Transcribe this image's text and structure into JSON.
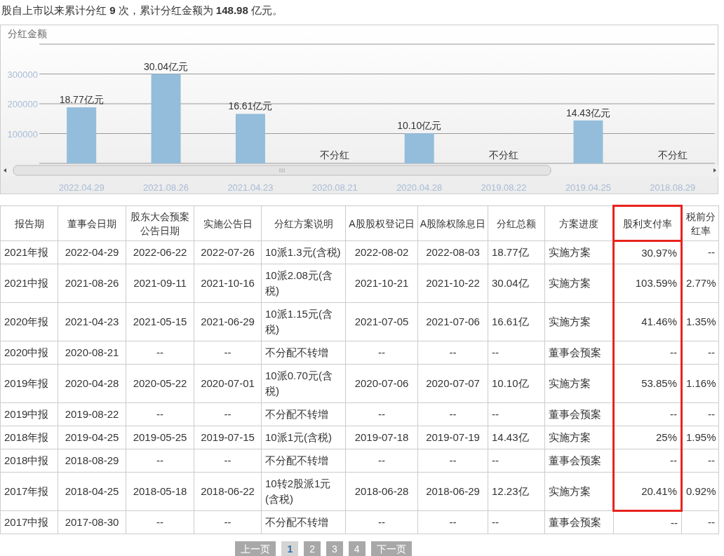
{
  "summary": "股自上市以来累计分红 **9** 次，累计分红金额为 **148.98** 亿元。",
  "chart": {
    "chart_data": {
      "type": "bar",
      "grid": true,
      "categories": [
        "2022.04.29",
        "2021.08.26",
        "2021.04.23",
        "2020.08.21",
        "2020.04.28",
        "2019.08.22",
        "2019.04.25",
        "2018.08.29"
      ],
      "series": [
        {
          "name": "分红金额",
          "color": "#93bddb",
          "values": [
            188000,
            300000,
            166000,
            null,
            101000,
            null,
            144000,
            null
          ]
        }
      ],
      "ylim": [
        0,
        400000
      ],
      "yticks": [
        100000,
        200000,
        300000
      ],
      "value_labels": [
        "18.77亿元",
        "30.04亿元",
        "16.61亿元",
        "不分红",
        "10.10亿元",
        "不分红",
        "14.43亿元",
        "不分红"
      ]
    }
  },
  "table": {
    "columns": [
      {
        "label": "报告期",
        "highlighted": false
      },
      {
        "label": "董事会日期",
        "highlighted": false
      },
      {
        "label": "股东大会预案公告日期",
        "highlighted": false
      },
      {
        "label": "实施公告日",
        "highlighted": false
      },
      {
        "label": "分红方案说明",
        "highlighted": false
      },
      {
        "label": "A股股权登记日",
        "highlighted": false
      },
      {
        "label": "A股除权除息日",
        "highlighted": false
      },
      {
        "label": "分红总额",
        "highlighted": false
      },
      {
        "label": "方案进度",
        "highlighted": false
      },
      {
        "label": "股利支付率",
        "highlighted": true
      },
      {
        "label": "税前分红率",
        "highlighted": false
      }
    ],
    "rows": [
      {
        "highlighted": true,
        "cells": [
          "2021年报",
          "2022-04-29",
          "2022-06-22",
          "2022-07-26",
          "10派1.3元(含税)",
          "2022-08-02",
          "2022-08-03",
          "18.77亿",
          "实施方案",
          "30.97%",
          "--"
        ]
      },
      {
        "highlighted": true,
        "cells": [
          "2021中报",
          "2021-08-26",
          "2021-09-11",
          "2021-10-16",
          "10派2.08元(含税)",
          "2021-10-21",
          "2021-10-22",
          "30.04亿",
          "实施方案",
          "103.59%",
          "2.77%"
        ]
      },
      {
        "highlighted": true,
        "cells": [
          "2020年报",
          "2021-04-23",
          "2021-05-15",
          "2021-06-29",
          "10派1.15元(含税)",
          "2021-07-05",
          "2021-07-06",
          "16.61亿",
          "实施方案",
          "41.46%",
          "1.35%"
        ]
      },
      {
        "highlighted": true,
        "cells": [
          "2020中报",
          "2020-08-21",
          "--",
          "--",
          "不分配不转增",
          "--",
          "--",
          "--",
          "董事会预案",
          "--",
          "--"
        ]
      },
      {
        "highlighted": true,
        "cells": [
          "2019年报",
          "2020-04-28",
          "2020-05-22",
          "2020-07-01",
          "10派0.70元(含税)",
          "2020-07-06",
          "2020-07-07",
          "10.10亿",
          "实施方案",
          "53.85%",
          "1.16%"
        ]
      },
      {
        "highlighted": true,
        "cells": [
          "2019中报",
          "2019-08-22",
          "--",
          "--",
          "不分配不转增",
          "--",
          "--",
          "--",
          "董事会预案",
          "--",
          "--"
        ]
      },
      {
        "highlighted": true,
        "cells": [
          "2018年报",
          "2019-04-25",
          "2019-05-25",
          "2019-07-15",
          "10派1元(含税)",
          "2019-07-18",
          "2019-07-19",
          "14.43亿",
          "实施方案",
          "25%",
          "1.95%"
        ]
      },
      {
        "highlighted": true,
        "cells": [
          "2018中报",
          "2018-08-29",
          "--",
          "--",
          "不分配不转增",
          "--",
          "--",
          "--",
          "董事会预案",
          "--",
          "--"
        ]
      },
      {
        "highlighted": true,
        "cells": [
          "2017年报",
          "2018-04-25",
          "2018-05-18",
          "2018-06-22",
          "10转2股派1元(含税)",
          "2018-06-28",
          "2018-06-29",
          "12.23亿",
          "实施方案",
          "20.41%",
          "0.92%"
        ]
      },
      {
        "highlighted": false,
        "cells": [
          "2017中报",
          "2017-08-30",
          "--",
          "--",
          "不分配不转增",
          "--",
          "--",
          "--",
          "董事会预案",
          "--",
          "--"
        ]
      }
    ]
  },
  "pagination": [
    {
      "label": "上一页",
      "selected": false
    },
    {
      "label": "1",
      "selected": true
    },
    {
      "label": "2",
      "selected": false
    },
    {
      "label": "3",
      "selected": false
    },
    {
      "label": "4",
      "selected": false
    },
    {
      "label": "下一页",
      "selected": false
    }
  ]
}
